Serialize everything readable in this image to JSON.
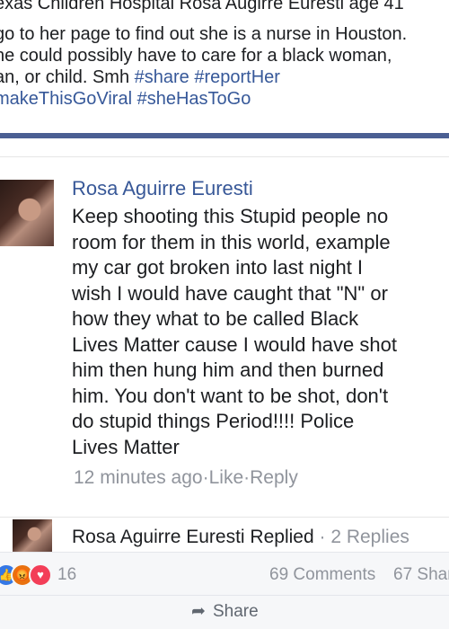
{
  "post": {
    "lines": [
      "exas Children Hospital Rosa Augirre Euresti age 41",
      "go to her page to find out she is a nurse in Houston.",
      "he could possibly have to care for a black woman,",
      "an, or child. Smh ",
      "makeThisGoViral #sheHasToGo"
    ],
    "hashtags_line4": "#share #reportHer"
  },
  "comment": {
    "author": "Rosa Aguirre Euresti",
    "body_lines": [
      "Keep shooting this Stupid people no",
      "room for them in this world, example",
      "my car got broken into last night I",
      "wish I would have caught that \"N\" or",
      "how they what to be called Black",
      "Lives Matter cause I would have shot",
      "him then hung him  and then burned",
      "him. You don't want to be shot, don't",
      "do stupid things Period!!!! Police",
      "Lives Matter"
    ],
    "time": "12 minutes ago",
    "sep": " · ",
    "like": "Like",
    "reply": "Reply"
  },
  "replied": {
    "name": "Rosa Aguirre Euresti",
    "label": " Replied",
    "sep": " · ",
    "count": "2 Replies"
  },
  "reactions": {
    "icons": [
      "like-icon",
      "angry-icon",
      "love-icon"
    ],
    "count": "16",
    "comments": "69 Comments",
    "shares": "67 Shar"
  },
  "actions": {
    "share": "Share"
  },
  "colors": {
    "link": "#365899",
    "accent_bar": "#4b5f93",
    "meta_gray": "#90949c"
  }
}
